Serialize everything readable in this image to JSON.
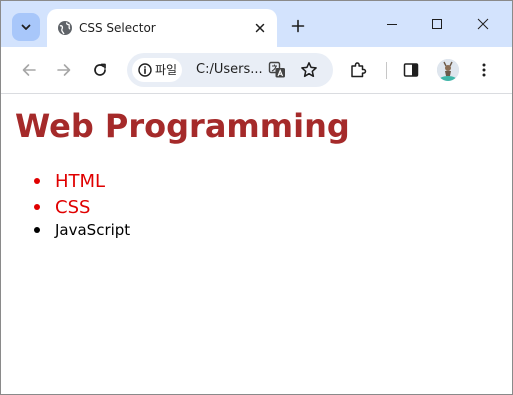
{
  "browser": {
    "tab": {
      "title": "CSS Selector"
    },
    "omnibox": {
      "chip_label": "파일",
      "url": "C:/Users..."
    },
    "icons": [
      "tab-search",
      "globe",
      "close",
      "new-tab",
      "minimize",
      "maximize",
      "window-close",
      "back",
      "forward",
      "reload",
      "info",
      "translate",
      "star",
      "extensions",
      "side-panel",
      "profile",
      "menu"
    ]
  },
  "page": {
    "heading": "Web Programming",
    "items": [
      {
        "label": "HTML",
        "color": "#e00000"
      },
      {
        "label": "CSS",
        "color": "#e00000"
      },
      {
        "label": "JavaScript",
        "color": "#000000"
      }
    ]
  },
  "colors": {
    "heading": "#a52a2a",
    "tabstrip": "#d3e3fd",
    "omnibox": "#e9eef6"
  }
}
